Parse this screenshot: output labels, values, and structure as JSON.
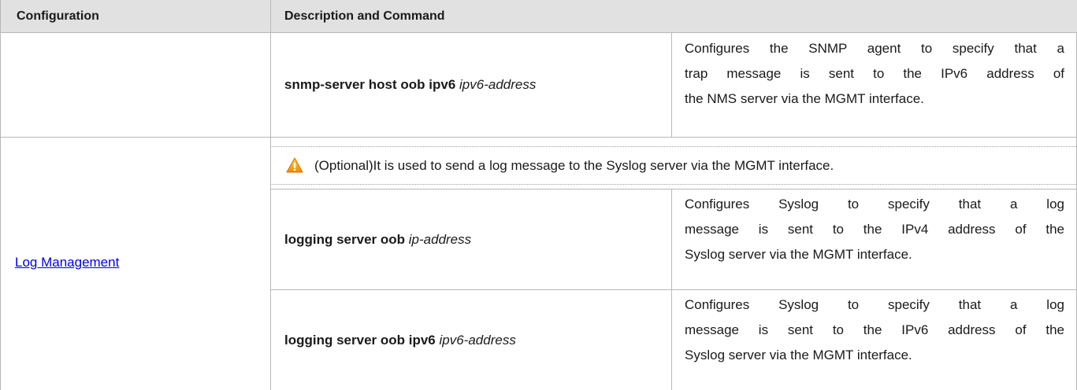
{
  "header": {
    "configuration": "Configuration",
    "description_command": "Description and Command"
  },
  "rows": [
    {
      "command_bold": "snmp-server host oob ipv6",
      "command_italic": "ipv6-address",
      "description_lines": [
        "Configures the SNMP agent to specify that a",
        "trap message is sent to the IPv6 address of",
        "the NMS server via the MGMT interface."
      ]
    }
  ],
  "log_management": {
    "link_label": "Log Management",
    "note": "(Optional)It is used to send a log message to the Syslog server via the MGMT interface.",
    "note_icon": "warning-icon",
    "commands": [
      {
        "command_bold": "logging server oob",
        "command_italic": "ip-address",
        "description_lines": [
          "Configures Syslog to specify that a log",
          "message is sent to the IPv4 address of the",
          "Syslog server via the MGMT interface."
        ]
      },
      {
        "command_bold": "logging server oob ipv6",
        "command_italic": "ipv6-address",
        "description_lines": [
          "Configures Syslog to specify that a log",
          "message is sent to the IPv6 address of the",
          "Syslog server via the MGMT interface."
        ]
      }
    ]
  },
  "colors": {
    "header_bg": "#e1e1e1",
    "border": "#b8b8b8",
    "link": "#0000ee",
    "warning_fill": "#f5a623"
  }
}
